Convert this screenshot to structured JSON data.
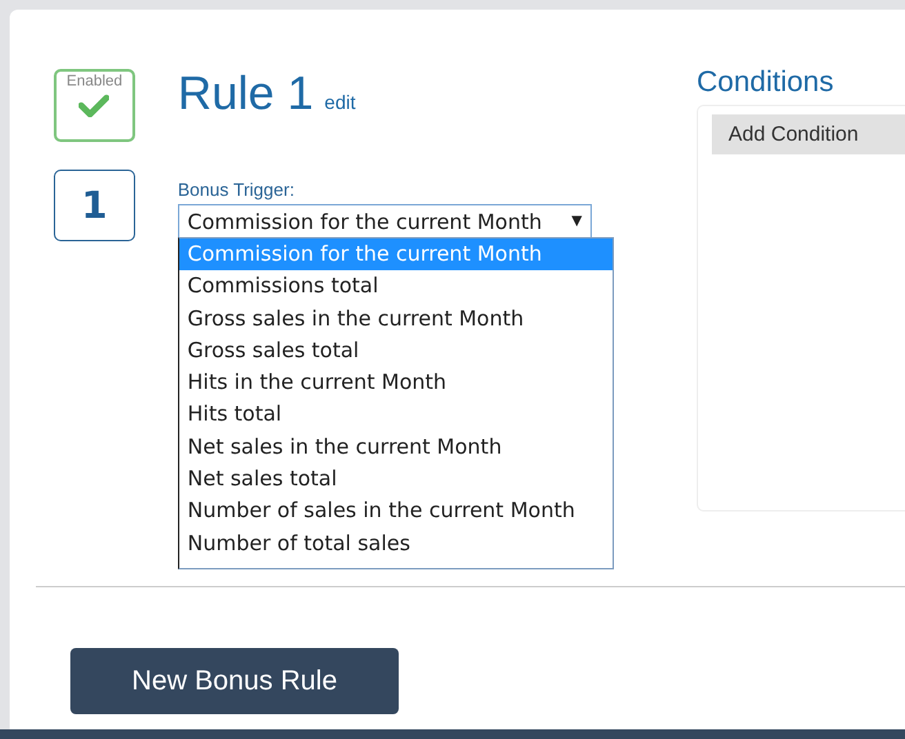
{
  "rule": {
    "enabled_label": "Enabled",
    "enabled": true,
    "number": "1",
    "title": "Rule 1",
    "edit_link": "edit"
  },
  "trigger": {
    "label": "Bonus Trigger:",
    "value": "Commission for the current Month",
    "arrow": "▼",
    "expanded": true,
    "options": [
      {
        "label": "Commission for the current Month",
        "selected": true
      },
      {
        "label": "Commissions total",
        "selected": false
      },
      {
        "label": "Gross sales in the current Month",
        "selected": false
      },
      {
        "label": "Gross sales total",
        "selected": false
      },
      {
        "label": "Hits in the current Month",
        "selected": false
      },
      {
        "label": "Hits total",
        "selected": false
      },
      {
        "label": "Net sales in the current Month",
        "selected": false
      },
      {
        "label": "Net sales total",
        "selected": false
      },
      {
        "label": "Number of sales in the current Month",
        "selected": false
      },
      {
        "label": "Number of total sales",
        "selected": false
      }
    ]
  },
  "conditions": {
    "title": "Conditions",
    "add_button": "Add Condition"
  },
  "new_rule_button": "New Bonus Rule"
}
